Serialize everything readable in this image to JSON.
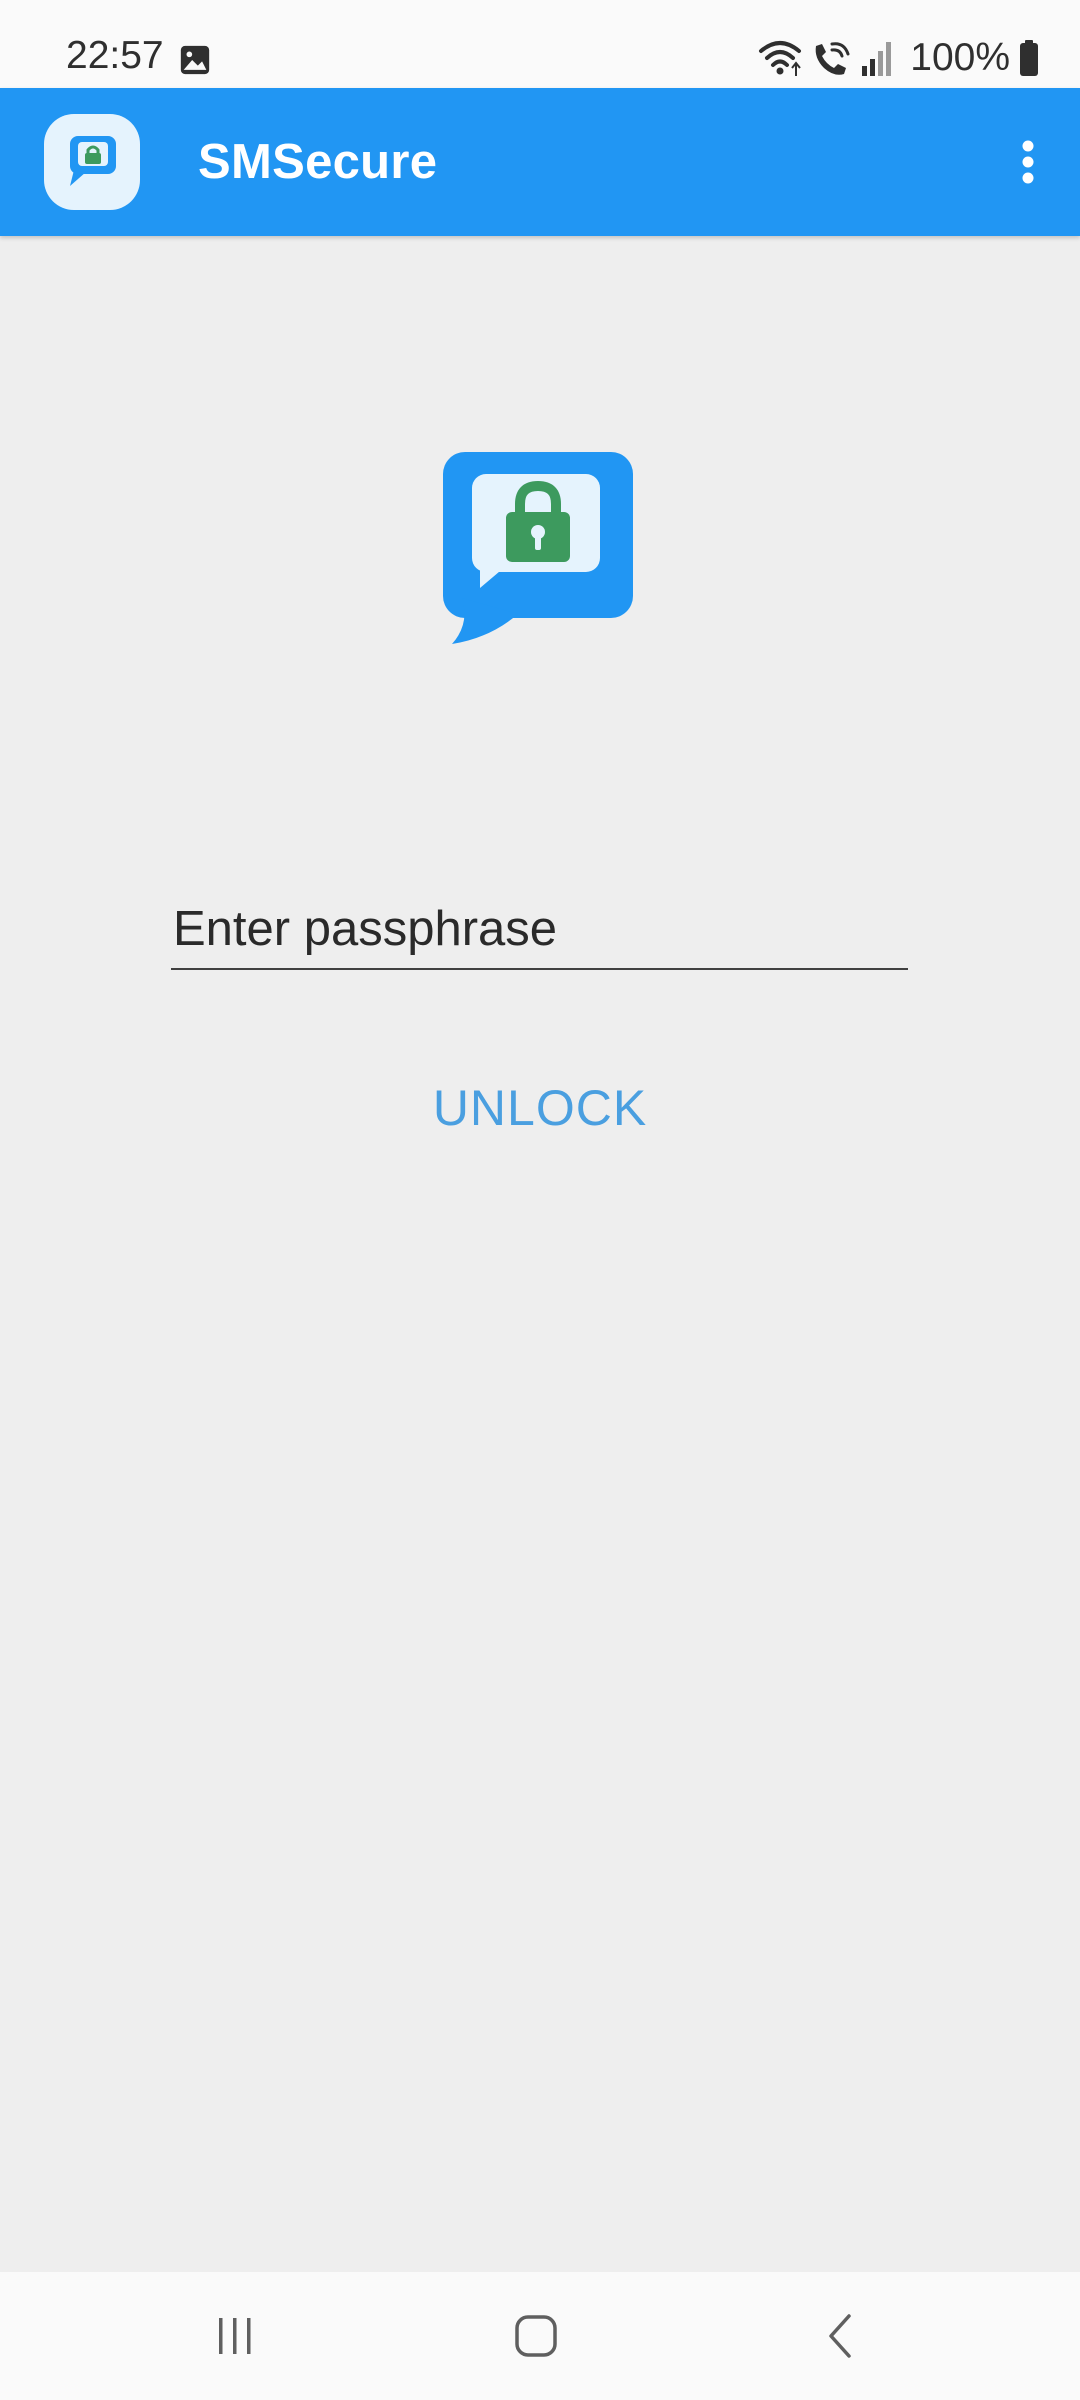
{
  "status_bar": {
    "time": "22:57",
    "battery_text": "100%",
    "icons": [
      "gallery-icon",
      "wifi-icon",
      "wifi-calling-icon",
      "signal-icon",
      "battery-icon"
    ]
  },
  "app_bar": {
    "title": "SMSecure",
    "logo_icon": "app-logo-icon",
    "overflow_icon": "more-vert-icon"
  },
  "lock_screen": {
    "icon": "secure-message-icon",
    "passphrase_placeholder": "Enter passphrase",
    "passphrase_value": "",
    "unlock_label": "UNLOCK"
  },
  "nav_bar": {
    "icons": [
      "recent-apps-icon",
      "home-icon",
      "back-icon"
    ]
  },
  "colors": {
    "app_bar": "#2196f3",
    "background": "#eeeeee",
    "accent_text": "#4a9fe0",
    "lock_green": "#3d9a5e"
  }
}
